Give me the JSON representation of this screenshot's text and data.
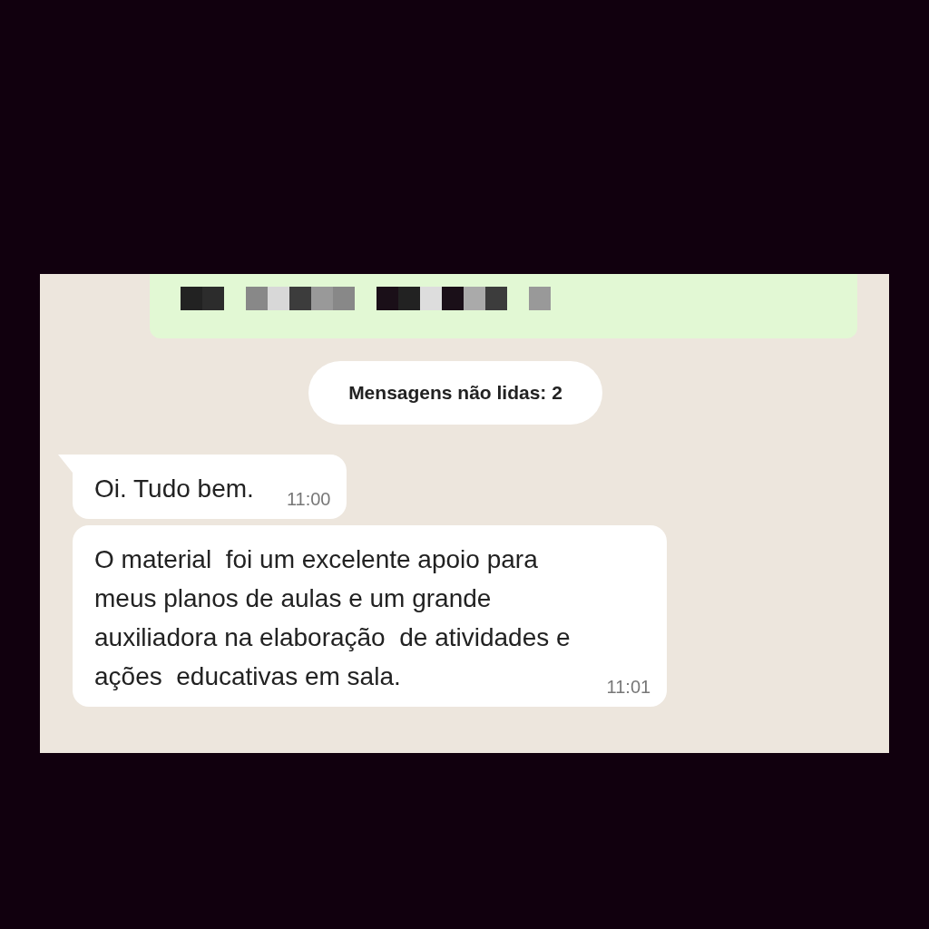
{
  "outgoing_bubble": {
    "kind": "redacted"
  },
  "unread_banner": "Mensagens não lidas: 2",
  "messages": [
    {
      "kind": "incoming",
      "tail": true,
      "lines": [
        "Oi. Tudo bem."
      ],
      "time": "11:00"
    },
    {
      "kind": "incoming",
      "tail": false,
      "lines": [
        "O material  foi um excelente apoio para",
        "meus planos de aulas e um grande",
        "auxiliadora na elaboração  de atividades e",
        "ações  educativas em sala."
      ],
      "time": "11:01"
    }
  ]
}
